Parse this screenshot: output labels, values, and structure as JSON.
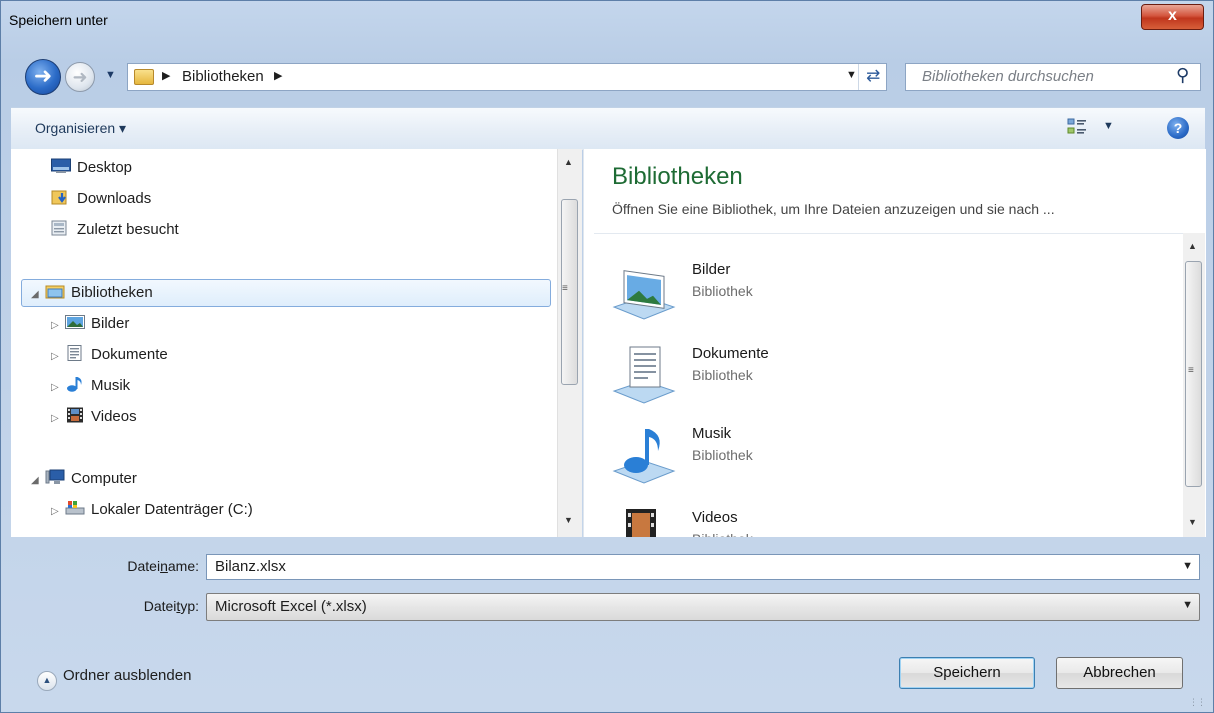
{
  "window": {
    "title": "Speichern unter",
    "close_label": "x"
  },
  "address": {
    "crumb": "Bibliotheken",
    "search_placeholder": "Bibliotheken durchsuchen"
  },
  "toolbar": {
    "organize_label": "Organisieren ▾",
    "help_label": "?"
  },
  "navtree": {
    "items": [
      {
        "label": "Desktop",
        "icon": "desktop-icon"
      },
      {
        "label": "Downloads",
        "icon": "downloads-icon"
      },
      {
        "label": "Zuletzt besucht",
        "icon": "recent-places-icon"
      },
      {
        "label": "Bibliotheken",
        "icon": "libraries-icon",
        "selected": true,
        "expanded": true
      },
      {
        "label": "Bilder",
        "icon": "pictures-icon"
      },
      {
        "label": "Dokumente",
        "icon": "documents-icon"
      },
      {
        "label": "Musik",
        "icon": "music-icon"
      },
      {
        "label": "Videos",
        "icon": "videos-icon"
      },
      {
        "label": "Computer",
        "icon": "computer-icon",
        "expanded": true
      },
      {
        "label": "Lokaler Datenträger (C:)",
        "icon": "drive-icon"
      }
    ]
  },
  "content": {
    "heading": "Bibliotheken",
    "description": "Öffnen Sie eine Bibliothek, um Ihre Dateien anzuzeigen und sie nach ...",
    "libraries": [
      {
        "name": "Bilder",
        "type": "Bibliothek",
        "icon": "pictures-library-icon"
      },
      {
        "name": "Dokumente",
        "type": "Bibliothek",
        "icon": "documents-library-icon"
      },
      {
        "name": "Musik",
        "type": "Bibliothek",
        "icon": "music-library-icon"
      },
      {
        "name": "Videos",
        "type": "Bibliothek",
        "icon": "videos-library-icon"
      }
    ]
  },
  "form": {
    "filename_label_pre": "Datei",
    "filename_label_u": "n",
    "filename_label_post": "ame:",
    "filename_value": "Bilanz.xlsx",
    "filetype_label_pre": "Datei",
    "filetype_label_u": "t",
    "filetype_label_post": "yp:",
    "filetype_value": "Microsoft Excel (*.xlsx)"
  },
  "footer": {
    "hide_folders_label": "Ordner ausblenden",
    "save_label": "Speichern",
    "cancel_label": "Abbrechen"
  },
  "colors": {
    "heading_green": "#1e6b34",
    "selection_border": "#84acdd",
    "close_red": "#c0361d"
  }
}
